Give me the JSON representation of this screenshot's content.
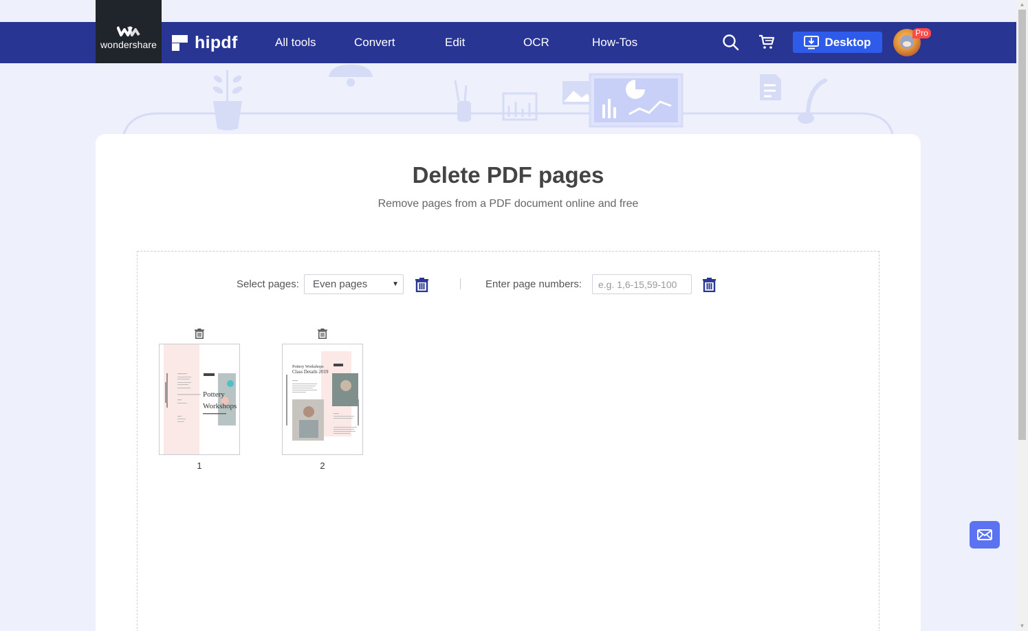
{
  "header": {
    "company_name": "wondershare",
    "brand_name": "hipdf",
    "nav": [
      {
        "label": "All tools"
      },
      {
        "label": "Convert"
      },
      {
        "label": "Edit"
      },
      {
        "label": "OCR"
      },
      {
        "label": "How-Tos"
      }
    ],
    "desktop_label": "Desktop",
    "pro_label": "Pro"
  },
  "page": {
    "title": "Delete PDF pages",
    "subtitle": "Remove pages from a PDF document online and free"
  },
  "controls": {
    "select_pages_label": "Select pages:",
    "select_pages_value": "Even pages",
    "page_numbers_label": "Enter page numbers:",
    "page_numbers_placeholder": "e.g. 1,6-15,59-100",
    "page_numbers_value": ""
  },
  "pages": [
    {
      "number": "1",
      "heading": "Pottery Workshops"
    },
    {
      "number": "2",
      "heading": "Pottery Workshops Class Details 2019"
    }
  ],
  "colors": {
    "header_bg": "#283593",
    "accent": "#2f5bea",
    "trash_icon": "#283593",
    "feedback_btn": "#5b73f0"
  },
  "icons": {
    "search": "search-icon",
    "cart": "cart-icon",
    "download": "download-icon",
    "trash": "trash-icon",
    "mail": "mail-icon"
  }
}
